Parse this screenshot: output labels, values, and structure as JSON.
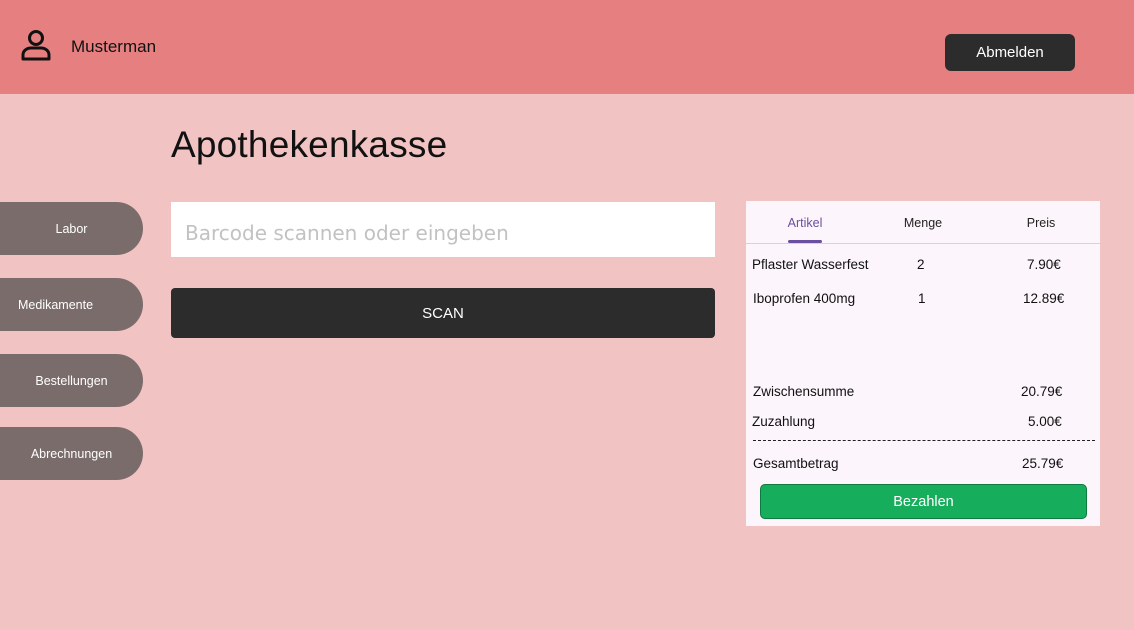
{
  "header": {
    "username": "Musterman",
    "user_icon": "user-icon",
    "logout_label": "Abmelden"
  },
  "page": {
    "title": "Apothekenkasse"
  },
  "sidebar": {
    "items": [
      {
        "label": "Labor"
      },
      {
        "label": "Medikamente"
      },
      {
        "label": "Bestellungen"
      },
      {
        "label": "Abrechnungen"
      }
    ]
  },
  "scanner": {
    "placeholder": "Barcode scannen oder eingeben",
    "value": "",
    "scan_label": "SCAN"
  },
  "cart": {
    "tabs": [
      {
        "label": "Artikel",
        "active": true
      },
      {
        "label": "Menge",
        "active": false
      },
      {
        "label": "Preis",
        "active": false
      }
    ],
    "items": [
      {
        "name": "Pflaster Wasserfest",
        "qty": "2",
        "price": "7.90€"
      },
      {
        "name": "Iboprofen 400mg",
        "qty": "1",
        "price": "12.89€"
      }
    ],
    "subtotal_label": "Zwischensumme",
    "subtotal_value": "20.79€",
    "copay_label": "Zuzahlung",
    "copay_value": "5.00€",
    "total_label": "Gesamtbetrag",
    "total_value": "25.79€",
    "pay_label": "Bezahlen"
  },
  "colors": {
    "background": "#f1c3c3",
    "header": "#e68080",
    "nav_button": "#7a6c6b",
    "dark_button": "#2c2c2c",
    "accent_tab": "#6b4fa0",
    "pay_button": "#16ad5c"
  }
}
